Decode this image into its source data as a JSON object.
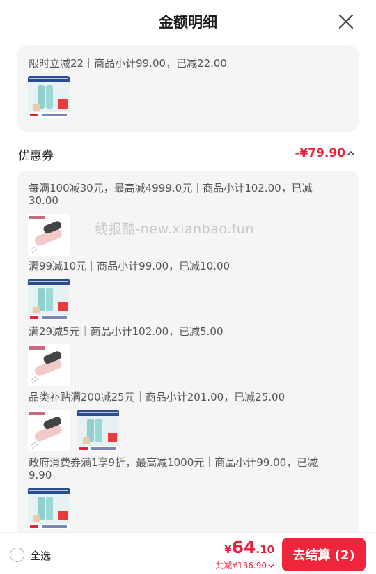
{
  "header": {
    "title": "金额明细"
  },
  "limited_discount": {
    "line": "限时立减22｜商品小计99.00，已减22.00"
  },
  "coupon": {
    "label": "优惠券",
    "amount": "-¥79.90"
  },
  "coupon_items": [
    {
      "line1": "每满100减30元，最高减4999.0元｜商品小计102.00，已减",
      "line2": "30.00",
      "thumbs": [
        "pink-case-product"
      ]
    },
    {
      "line1": "满99减10元｜商品小计99.00，已减10.00",
      "thumbs": [
        "thermos-product"
      ]
    },
    {
      "line1": "满29减5元｜商品小计102.00，已减5.00",
      "thumbs": [
        "pink-case-product"
      ]
    },
    {
      "line1": "品类补贴满200减25元｜商品小计201.00，已减25.00",
      "thumbs": [
        "pink-case-product",
        "thermos-product"
      ]
    },
    {
      "line1": "政府消费券满1享9折，最高减1000元｜商品小计99.00，已减",
      "line2": "9.90",
      "thumbs": [
        "thermos-product"
      ]
    }
  ],
  "watermark": "线报酷-new.xianbao.fun",
  "footer": {
    "select_all": "全选",
    "price_symbol": "¥",
    "price_int": "64",
    "price_dec": ".10",
    "discount_text": "共减¥136.90",
    "checkout_label": "去结算 (2)"
  },
  "colors": {
    "accent": "#f0243a",
    "price": "#e8203a",
    "card_bg": "#f5f5f5"
  }
}
